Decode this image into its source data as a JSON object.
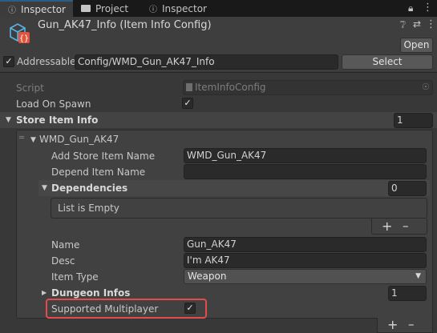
{
  "tabs": [
    {
      "label": "Inspector",
      "icon": "info-icon"
    },
    {
      "label": "Project",
      "icon": "folder-icon"
    },
    {
      "label": "Inspector",
      "icon": "info-icon"
    }
  ],
  "header": {
    "title": "Gun_AK47_Info (Item Info Config)",
    "open_label": "Open"
  },
  "addressable": {
    "label": "Addressable",
    "checked": true,
    "path": "Config/WMD_Gun_AK47_Info",
    "select_label": "Select"
  },
  "script": {
    "label": "Script",
    "value": "ItemInfoConfig"
  },
  "load_on_spawn": {
    "label": "Load On Spawn",
    "checked": true
  },
  "store_item_info": {
    "label": "Store Item Info",
    "count": "1",
    "element": {
      "title": "WMD_Gun_AK47",
      "add_store_item_name": {
        "label": "Add Store Item Name",
        "value": "WMD_Gun_AK47"
      },
      "depend_item_name": {
        "label": "Depend Item Name",
        "value": ""
      },
      "dependencies": {
        "label": "Dependencies",
        "count": "0",
        "empty_text": "List is Empty"
      },
      "name": {
        "label": "Name",
        "value": "Gun_AK47"
      },
      "desc": {
        "label": "Desc",
        "value": "I'm AK47"
      },
      "item_type": {
        "label": "Item Type",
        "value": "Weapon"
      },
      "dungeon_infos": {
        "label": "Dungeon Infos",
        "count": "1"
      },
      "supported_multiplayer": {
        "label": "Supported Multiplayer",
        "checked": true
      }
    }
  },
  "colors": {
    "highlight": "#e64b4b",
    "tab_accent": "#2c5d87"
  }
}
